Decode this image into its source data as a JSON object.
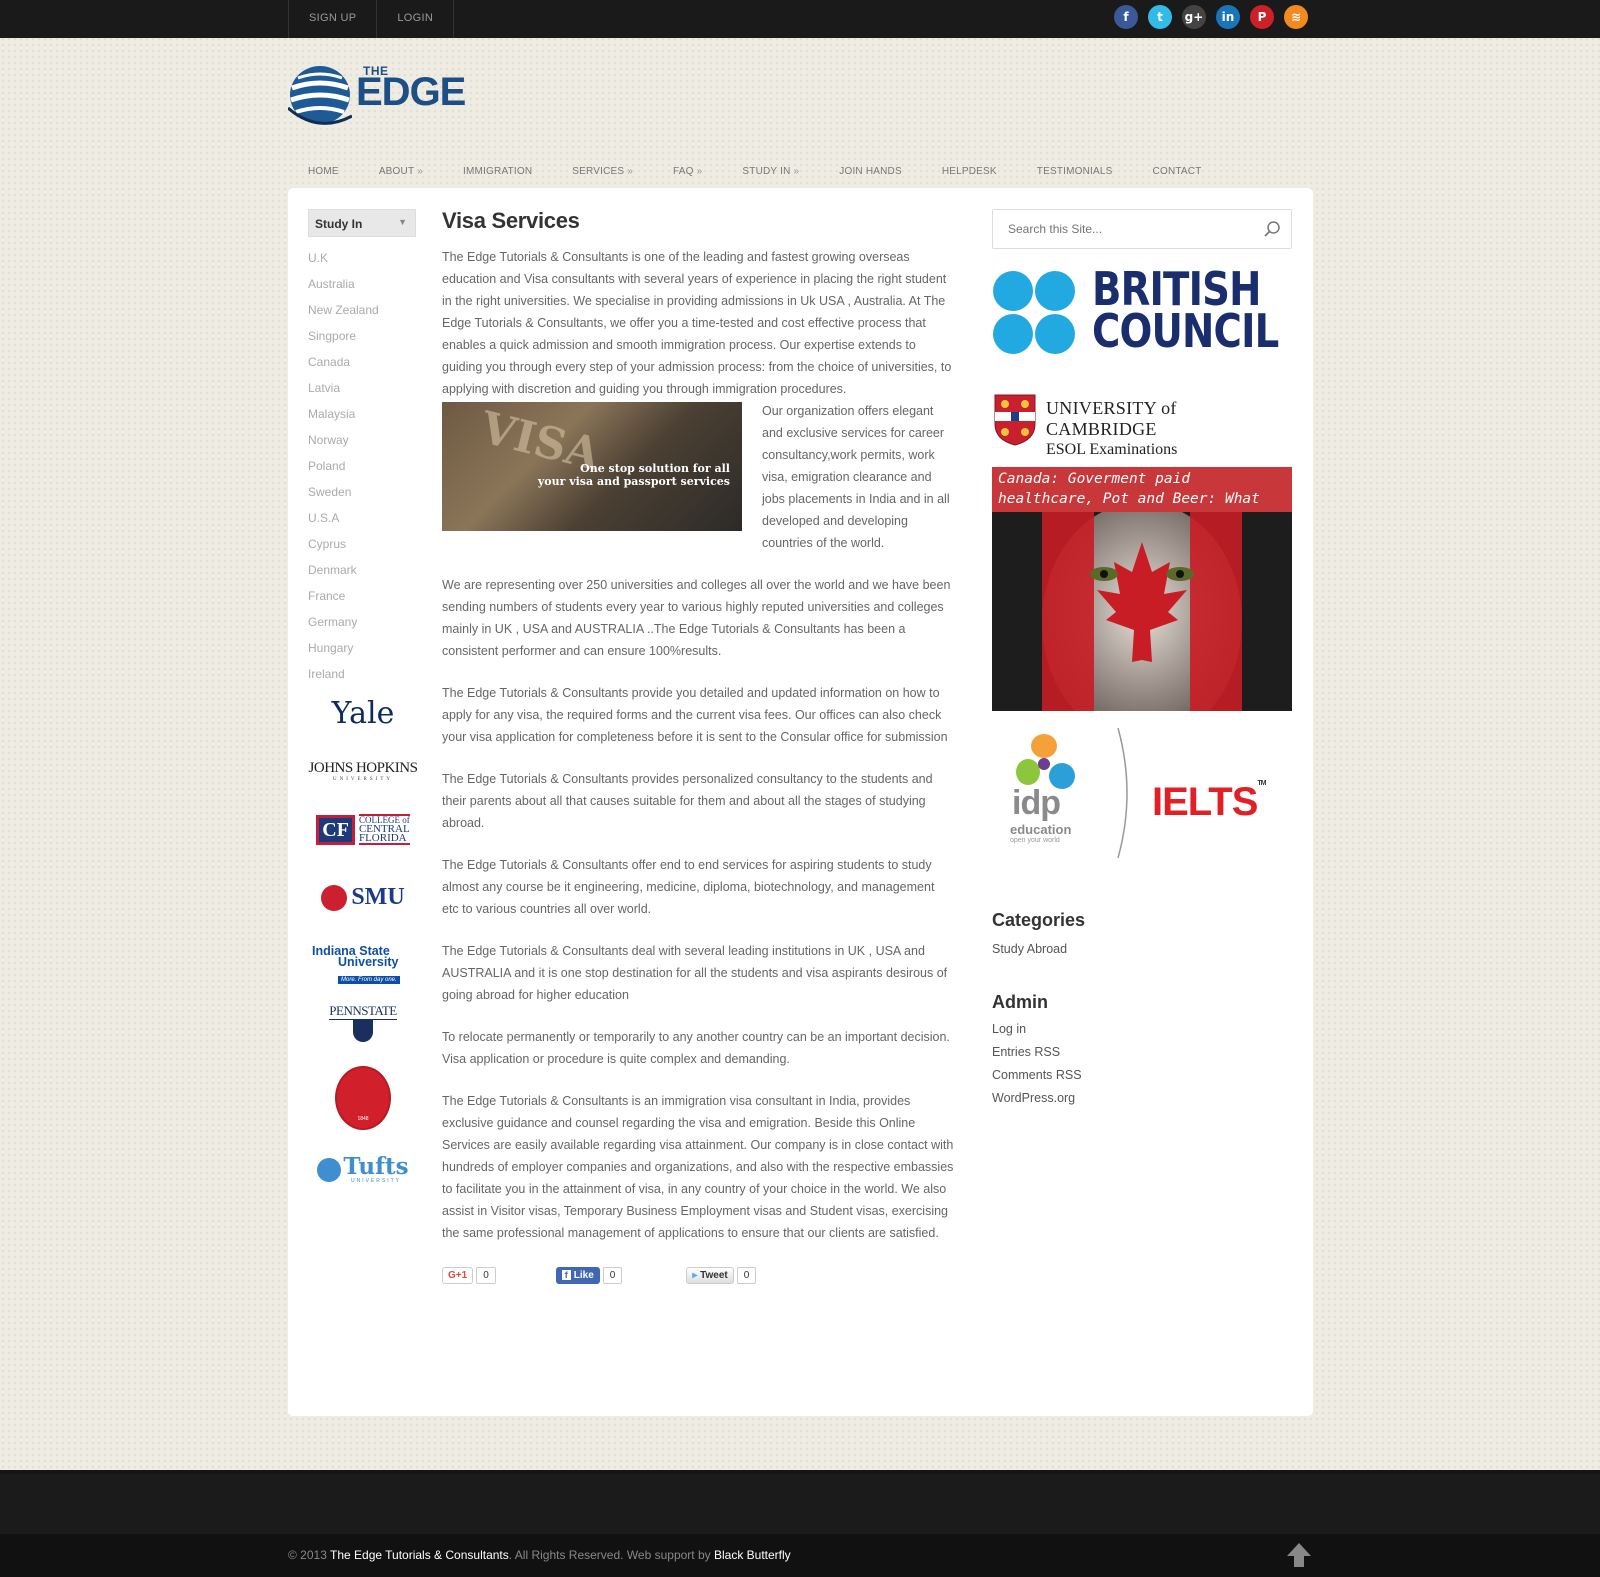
{
  "topbar": {
    "signup": "SIGN UP",
    "login": "LOGIN",
    "social": [
      {
        "icon": "facebook-icon",
        "glyph": "f",
        "color": "#3b5998"
      },
      {
        "icon": "twitter-icon",
        "glyph": "t",
        "color": "#33bbe8"
      },
      {
        "icon": "google-plus-icon",
        "glyph": "g+",
        "color": "#444444"
      },
      {
        "icon": "linkedin-icon",
        "glyph": "in",
        "color": "#1b75bb"
      },
      {
        "icon": "pinterest-icon",
        "glyph": "P",
        "color": "#cc2127"
      },
      {
        "icon": "rss-icon",
        "glyph": "≋",
        "color": "#f28a1f"
      }
    ]
  },
  "logo": {
    "the": "THE",
    "edge": "EDGE"
  },
  "nav": {
    "home": "HOME",
    "about": "ABOUT",
    "immigration": "IMMIGRATION",
    "services": "SERVICES",
    "faq": "FAQ",
    "study_in": "STUDY IN",
    "join_hands": "JOIN HANDS",
    "helpdesk": "HELPDESK",
    "testimonials": "TESTIMONIALS",
    "contact": "CONTACT",
    "arrow": "»"
  },
  "sidebar": {
    "dropdown_label": "Study In",
    "countries": [
      "U.K",
      "Australia",
      "New Zealand",
      "Singpore",
      "Canada",
      "Latvia",
      "Malaysia",
      "Norway",
      "Poland",
      "Sweden",
      "U.S.A",
      "Cyprus",
      "Denmark",
      "France",
      "Germany",
      "Hungary",
      "Ireland"
    ],
    "universities": {
      "yale": "Yale",
      "jhu": "JOHNS HOPKINS",
      "jhu_sub": "UNIVERSITY",
      "ccf_mark": "CF",
      "ccf_line1": "COLLEGE of",
      "ccf_line2": "CENTRAL",
      "ccf_line3": "FLORIDA",
      "smu": "SMU",
      "isu_line1": "Indiana State",
      "isu_line2": "University",
      "isu_tag": "More. From day one.",
      "pennstate": "PENNSTATE",
      "olemiss_year": "1848",
      "tufts": "Tufts",
      "tufts_sub": "UNIVERSITY"
    }
  },
  "content": {
    "title": "Visa Services",
    "p1": "The Edge Tutorials & Consultants is one of the leading and fastest growing overseas education and Visa consultants with several years of experience in placing the right student in the right universities. We specialise in providing admissions in Uk USA , Australia. At The Edge Tutorials & Consultants, we offer you a time-tested and cost effective process that enables a quick admission and smooth immigration process. Our expertise extends to guiding you through every step of your admission process: from the choice of universities, to applying with discretion and guiding you through immigration procedures.",
    "p1b": "Our organization offers elegant and exclusive services for career consultancy,work permits, work visa, emigration clearance and jobs placements in India and in all developed and developing countries of the world.",
    "visa_word": "VISA",
    "visa_caption_1": "One stop solution for all",
    "visa_caption_2": "your visa and passport services",
    "p2": "We are representing over 250 universities and colleges all over the world and we have been sending numbers of students every year to various highly reputed universities and colleges mainly in UK , USA and AUSTRALIA ..The Edge Tutorials & Consultants has been a consistent performer and can ensure 100%results.",
    "p3": "The Edge Tutorials & Consultants provide you detailed and updated information on how to apply for any visa, the required forms and the current visa fees. Our offices can also check your visa application for completeness before it is sent to the Consular office for submission",
    "p4": "The Edge Tutorials & Consultants provides personalized consultancy to the students and their parents about all that causes suitable for them and about all the stages of studying abroad.",
    "p5": "The Edge Tutorials & Consultants offer end to end services for aspiring students to study almost any course be it engineering, medicine, diploma, biotechnology, and management etc to various countries all over world.",
    "p6": "The Edge Tutorials & Consultants deal with several leading institutions in UK , USA and AUSTRALIA and it is one stop destination for all the students and visa aspirants desirous of going abroad for higher education",
    "p7": "To relocate permanently or temporarily to any another country can be an important decision. Visa application or procedure is quite complex and demanding.",
    "p8": "The Edge Tutorials & Consultants is an immigration visa consultant in India, provides exclusive guidance and counsel regarding the visa and emigration. Beside this Online Services are easily available regarding visa attainment. Our company is in close contact with hundreds of employer companies and organizations, and also with the respective embassies to facilitate you in the attainment of visa, in any country of your choice in the world. We also assist in Visitor visas, Temporary Business Employment visas and Student visas, exercising the same professional management of applications to ensure that our clients are satisfied.",
    "share": {
      "gplus_label": "G+1",
      "gplus_count": "0",
      "like_label": "Like",
      "like_count": "0",
      "tweet_label": "Tweet",
      "tweet_count": "0"
    }
  },
  "right": {
    "search_placeholder": "Search this Site...",
    "british_council_1": "BRITISH",
    "british_council_2": "COUNCIL",
    "cambridge_1": "UNIVERSITY of CAMBRIDGE",
    "cambridge_2": "ESOL Examinations",
    "canada_banner": "Canada: Goverment paid healthcare, Pot and Beer: What is not to Love?",
    "idp_word": "idp",
    "idp_education": "education",
    "idp_tag": "open your world",
    "ielts": "IELTS",
    "ielts_tm": "TM",
    "categories_title": "Categories",
    "categories": [
      "Study Abroad"
    ],
    "admin_title": "Admin",
    "admin_links": [
      "Log in",
      "Entries RSS",
      "Comments RSS",
      "WordPress.org"
    ]
  },
  "footer": {
    "copyright": "© 2013",
    "company": "The Edge Tutorials & Consultants",
    "rights": ". All Rights Reserved. Web support by",
    "support": "Black Butterfly"
  }
}
